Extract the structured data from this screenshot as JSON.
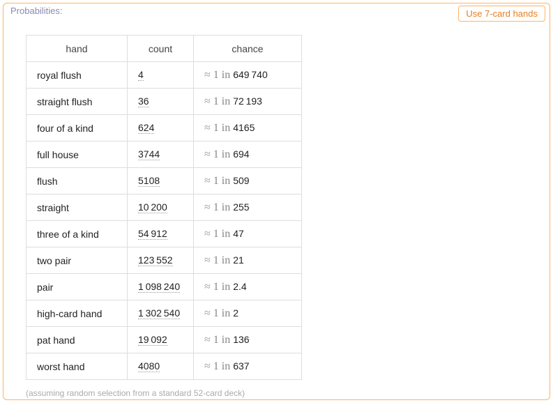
{
  "panel": {
    "title": "Probabilities:",
    "button_label": "Use 7-card hands",
    "footnote": "(assuming random selection from a standard 52-card deck)"
  },
  "table": {
    "headers": {
      "hand": "hand",
      "count": "count",
      "chance": "chance"
    },
    "approx_symbol": "≈",
    "one_in_prefix": "1 in",
    "rows": [
      {
        "hand": "royal flush",
        "count": "4",
        "odds": "649 740"
      },
      {
        "hand": "straight flush",
        "count": "36",
        "odds": "72 193"
      },
      {
        "hand": "four of a kind",
        "count": "624",
        "odds": "4165"
      },
      {
        "hand": "full house",
        "count": "3744",
        "odds": "694"
      },
      {
        "hand": "flush",
        "count": "5108",
        "odds": "509"
      },
      {
        "hand": "straight",
        "count": "10 200",
        "odds": "255"
      },
      {
        "hand": "three of a kind",
        "count": "54 912",
        "odds": "47"
      },
      {
        "hand": "two pair",
        "count": "123 552",
        "odds": "21"
      },
      {
        "hand": "pair",
        "count": "1 098 240",
        "odds": "2.4"
      },
      {
        "hand": "high-card hand",
        "count": "1 302 540",
        "odds": "2"
      },
      {
        "hand": "pat hand",
        "count": "19 092",
        "odds": "136"
      },
      {
        "hand": "worst hand",
        "count": "4080",
        "odds": "637"
      }
    ]
  }
}
